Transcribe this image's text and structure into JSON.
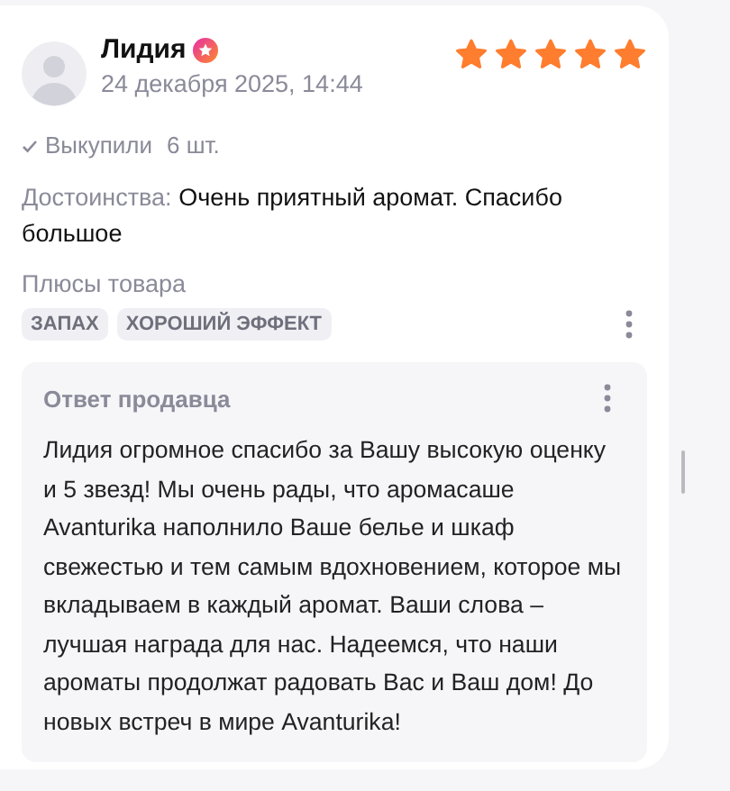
{
  "review": {
    "author": "Лидия",
    "date": "24 декабря 2025, 14:44",
    "stars": 5,
    "purchase": {
      "label": "Выкупили",
      "quantity": "6 шт."
    },
    "pros": {
      "label": "Достоинства:",
      "text": "Очень приятный аромат. Спасибо большое"
    },
    "tags_title": "Плюсы товара",
    "tags": [
      "ЗАПАХ",
      "ХОРОШИЙ ЭФФЕКТ"
    ],
    "seller_reply": {
      "title": "Ответ продавца",
      "text": "Лидия огромное спасибо за Вашу высокую оценку и 5 звезд! Мы очень рады, что аромасаше Avanturika наполнило Ваше белье и шкаф свежестью и тем самым вдохновением, которое мы вкладываем в каждый аромат. Ваши слова – лучшая награда для нас. Надеемся, что наши ароматы продолжат радовать Вас и Ваш дом! До новых встреч в мире Avanturika!"
    }
  }
}
